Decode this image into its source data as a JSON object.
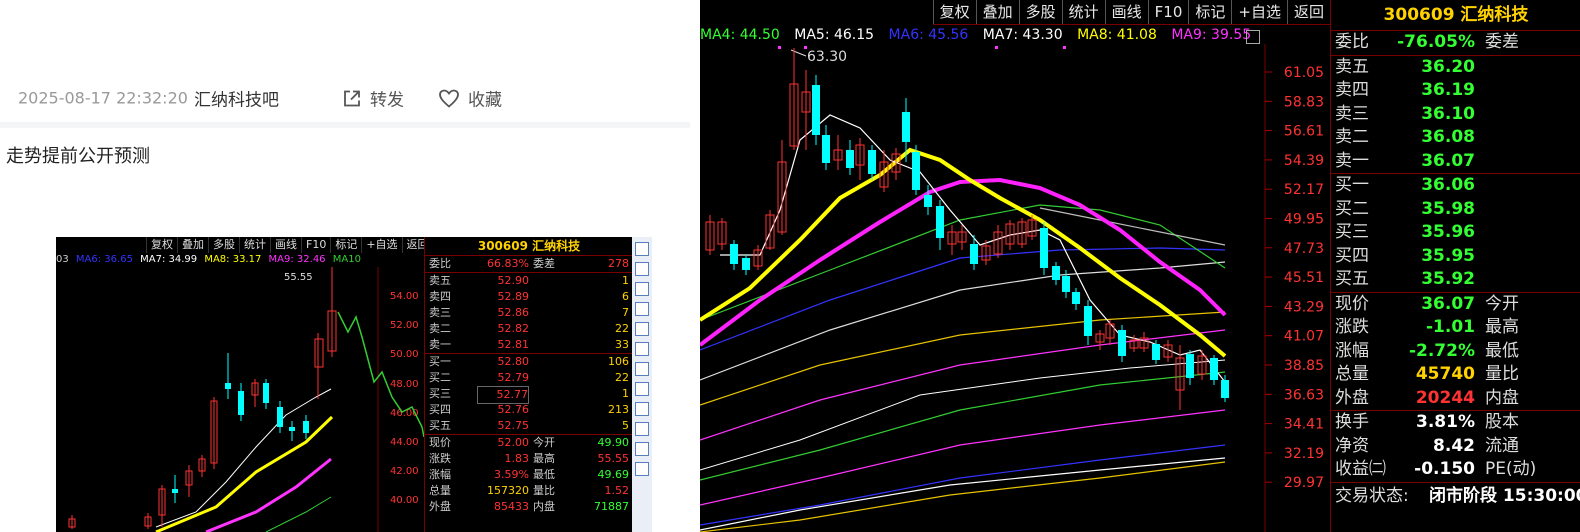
{
  "post": {
    "timestamp": "2025-08-17 22:32:20",
    "forum": "汇纳科技吧",
    "share_label": "转发",
    "favorite_label": "收藏",
    "text": "走势提前公开预测"
  },
  "mini": {
    "toolbar": [
      "复权",
      "叠加",
      "多股",
      "统计",
      "画线",
      "F10",
      "标记",
      "+自选",
      "返回"
    ],
    "ma": [
      {
        "label": "03",
        "color": "#cccccc"
      },
      {
        "label": "MA6: 36.65",
        "color": "#3333ff"
      },
      {
        "label": "MA7: 34.99",
        "color": "#ffffff"
      },
      {
        "label": "MA8: 33.17",
        "color": "#ffff00"
      },
      {
        "label": "MA9: 32.46",
        "color": "#ff33ff"
      },
      {
        "label": "MA10",
        "color": "#33cc33"
      }
    ],
    "peak_label": "55.55",
    "axis": [
      "54.00",
      "52.00",
      "50.00",
      "48.00",
      "46.00",
      "44.00",
      "42.00",
      "40.00"
    ],
    "quote": {
      "title": "300609 汇纳科技",
      "wb_label": "委比",
      "wb_value": "66.83%",
      "wc_label": "委差",
      "wc_value": "278",
      "asks": [
        {
          "label": "卖五",
          "price": "52.90",
          "vol": "1"
        },
        {
          "label": "卖四",
          "price": "52.89",
          "vol": "6"
        },
        {
          "label": "卖三",
          "price": "52.86",
          "vol": "7"
        },
        {
          "label": "卖二",
          "price": "52.82",
          "vol": "22"
        },
        {
          "label": "卖一",
          "price": "52.81",
          "vol": "33"
        }
      ],
      "bids": [
        {
          "label": "买一",
          "price": "52.80",
          "vol": "106"
        },
        {
          "label": "买二",
          "price": "52.79",
          "vol": "22"
        },
        {
          "label": "买三",
          "price": "52.77",
          "vol": "1"
        },
        {
          "label": "买四",
          "price": "52.76",
          "vol": "213"
        },
        {
          "label": "买五",
          "price": "52.75",
          "vol": "5"
        }
      ],
      "stats": [
        {
          "l": "现价",
          "v": "52.00",
          "l2": "今开",
          "v2": "49.90"
        },
        {
          "l": "涨跌",
          "v": "1.83",
          "l2": "最高",
          "v2": "55.55"
        },
        {
          "l": "涨幅",
          "v": "3.59%",
          "l2": "最低",
          "v2": "49.69"
        },
        {
          "l": "总量",
          "v": "157320",
          "l2": "量比",
          "v2": "1.52"
        },
        {
          "l": "外盘",
          "v": "85433",
          "l2": "内盘",
          "v2": "71887"
        }
      ]
    }
  },
  "chart": {
    "toolbar": [
      "复权",
      "叠加",
      "多股",
      "统计",
      "画线",
      "F10",
      "标记",
      "+自选",
      "返回"
    ],
    "ma": [
      {
        "label": "MA4: 44.50",
        "color": "#33ff33"
      },
      {
        "label": "MA5: 46.15",
        "color": "#ffffff"
      },
      {
        "label": "MA6: 45.56",
        "color": "#3333ff"
      },
      {
        "label": "MA7: 43.30",
        "color": "#ffffff"
      },
      {
        "label": "MA8: 41.08",
        "color": "#ffff00"
      },
      {
        "label": "MA9: 39.55",
        "color": "#ff33ff"
      }
    ],
    "peak_label": "63.30",
    "axis_values": [
      "61.05",
      "58.83",
      "56.61",
      "54.39",
      "52.17",
      "49.95",
      "47.73",
      "45.51",
      "43.29",
      "41.07",
      "38.85",
      "36.63",
      "34.41",
      "32.19",
      "29.97"
    ]
  },
  "quote": {
    "title": "300609 汇纳科技",
    "wb_label": "委比",
    "wb_value": "-76.05%",
    "wc_label": "委差",
    "asks": [
      {
        "label": "卖五",
        "price": "36.20"
      },
      {
        "label": "卖四",
        "price": "36.19"
      },
      {
        "label": "卖三",
        "price": "36.10"
      },
      {
        "label": "卖二",
        "price": "36.08"
      },
      {
        "label": "卖一",
        "price": "36.07"
      }
    ],
    "bids": [
      {
        "label": "买一",
        "price": "36.06"
      },
      {
        "label": "买二",
        "price": "35.98"
      },
      {
        "label": "买三",
        "price": "35.96"
      },
      {
        "label": "买四",
        "price": "35.95"
      },
      {
        "label": "买五",
        "price": "35.92"
      }
    ],
    "stats": [
      {
        "l": "现价",
        "v": "36.07",
        "c": "#33ff33",
        "l2": "今开"
      },
      {
        "l": "涨跌",
        "v": "-1.01",
        "c": "#33ff33",
        "l2": "最高"
      },
      {
        "l": "涨幅",
        "v": "-2.72%",
        "c": "#33ff33",
        "l2": "最低"
      },
      {
        "l": "总量",
        "v": "45740",
        "c": "#ffd200",
        "l2": "量比"
      },
      {
        "l": "外盘",
        "v": "20244",
        "c": "#ff3333",
        "l2": "内盘"
      }
    ],
    "stats2": [
      {
        "l": "换手",
        "v": "3.81%",
        "l2": "股本"
      },
      {
        "l": "净资",
        "v": "8.42",
        "l2": "流通"
      },
      {
        "l": "收益㈡",
        "v": "-0.150",
        "l2": "PE(动)"
      }
    ],
    "status_label": "交易状态:",
    "status_value": "闭市阶段 15:30:00"
  }
}
